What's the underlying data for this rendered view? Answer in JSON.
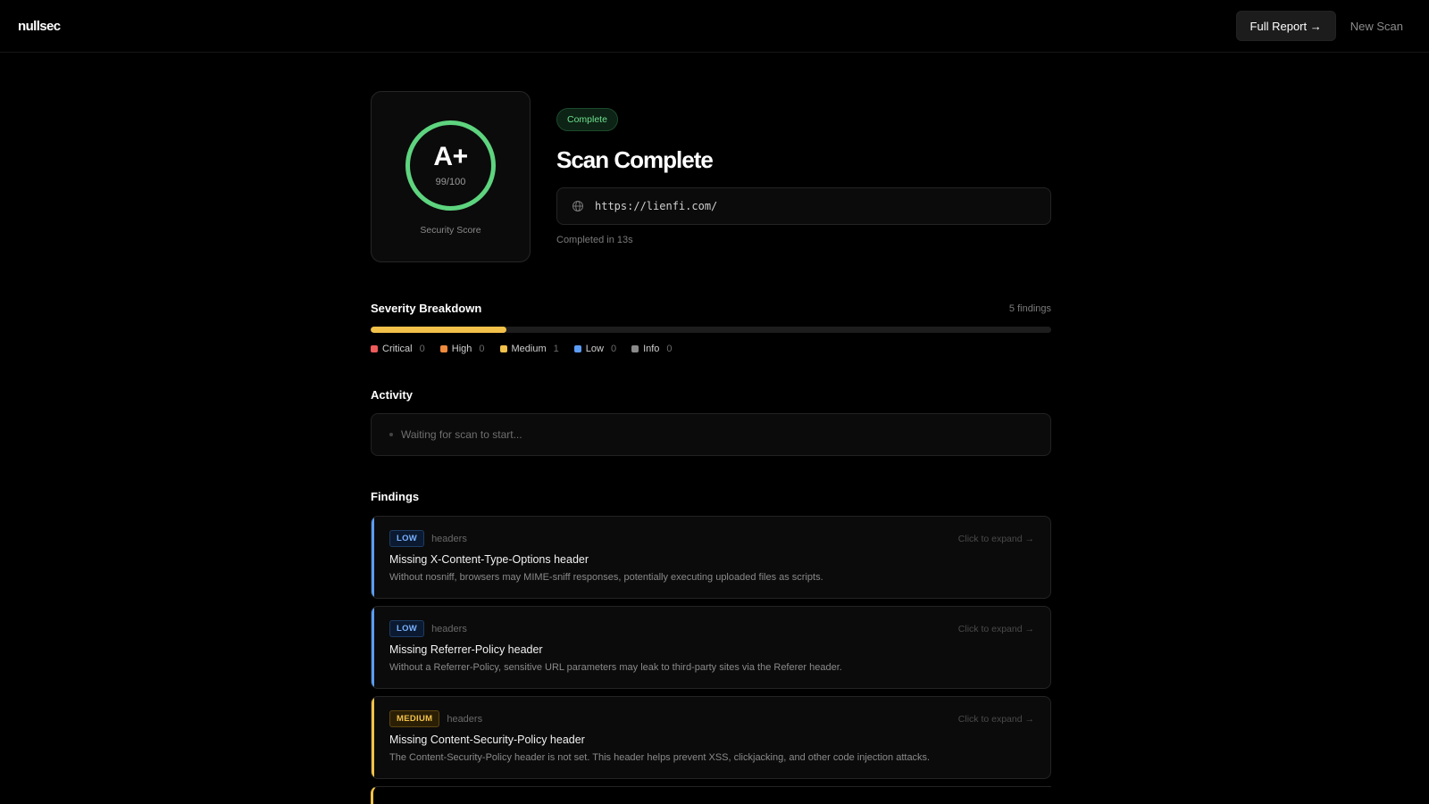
{
  "nav": {
    "logo": "nullsec",
    "full_report": "Full Report →",
    "new_scan": "New Scan"
  },
  "score": {
    "grade": "A+",
    "value": "99/100",
    "label": "Security Score",
    "ring_color": "#5ed47f"
  },
  "scan": {
    "status": "Complete",
    "title": "Scan Complete",
    "url": "https://lienfi.com/",
    "completed": "Completed in 13s"
  },
  "severity": {
    "title": "Severity Breakdown",
    "count": "5 findings",
    "bar_fill_fraction": 0.2,
    "bar_color": "#f2c14a",
    "items": [
      {
        "label": "Critical",
        "count": "0",
        "color": "#ef5a5a"
      },
      {
        "label": "High",
        "count": "0",
        "color": "#f08a3c"
      },
      {
        "label": "Medium",
        "count": "1",
        "color": "#f2c14a"
      },
      {
        "label": "Low",
        "count": "0",
        "color": "#5b9cf5"
      },
      {
        "label": "Info",
        "count": "0",
        "color": "#8a8a8a"
      }
    ]
  },
  "activity": {
    "title": "Activity",
    "text": "Waiting for scan to start..."
  },
  "findings": {
    "title": "Findings",
    "expand_label": "Click to expand →",
    "items": [
      {
        "severity": "LOW",
        "category": "headers",
        "title": "Missing X-Content-Type-Options header",
        "description": "Without nosniff, browsers may MIME-sniff responses, potentially executing uploaded files as scripts.",
        "accent": "#5b9cf5"
      },
      {
        "severity": "LOW",
        "category": "headers",
        "title": "Missing Referrer-Policy header",
        "description": "Without a Referrer-Policy, sensitive URL parameters may leak to third-party sites via the Referer header.",
        "accent": "#5b9cf5"
      },
      {
        "severity": "MEDIUM",
        "category": "headers",
        "title": "Missing Content-Security-Policy header",
        "description": "The Content-Security-Policy header is not set. This header helps prevent XSS, clickjacking, and other code injection attacks.",
        "accent": "#f2c14a"
      }
    ]
  }
}
